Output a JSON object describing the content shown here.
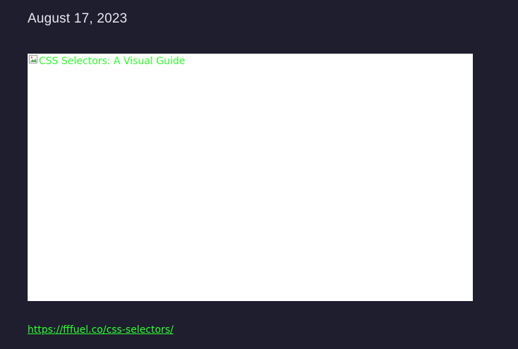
{
  "post": {
    "date": "August 17, 2023",
    "image_alt": "CSS Selectors: A Visual Guide",
    "link_text": "https://fffuel.co/css-selectors/",
    "link_href": "https://fffuel.co/css-selectors/"
  },
  "colors": {
    "background": "#1e1e2f",
    "link": "#30ff30",
    "text": "#e6e6ef"
  },
  "icons": {
    "broken_image": "broken-image-icon"
  }
}
